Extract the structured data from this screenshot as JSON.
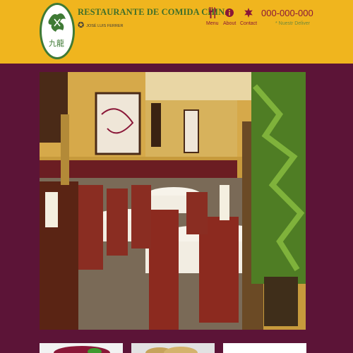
{
  "header": {
    "restaurant_name": "RESTAURANTE DE COMIDA CHINA",
    "owner": "JOSÉ LUIS FERRER",
    "logo_icon": "dragon-logo",
    "phone": "000-000-000",
    "deliver_link": "* Nuestr Deliver"
  },
  "nav": {
    "items": [
      {
        "label": "Menu",
        "icon": "fork-knife-icon"
      },
      {
        "label": "About",
        "icon": "info-icon"
      },
      {
        "label": "Contact",
        "icon": "contact-icon"
      }
    ]
  },
  "colors": {
    "header_bg": "#f0b51e",
    "page_bg": "#5c1437",
    "brand_green": "#3f6f2a",
    "nav_accent": "#8a1738"
  },
  "hero": {
    "image": "restaurant-dining-room-photo"
  },
  "thumbnails": [
    "food-photo",
    "food-photo",
    "blank"
  ]
}
